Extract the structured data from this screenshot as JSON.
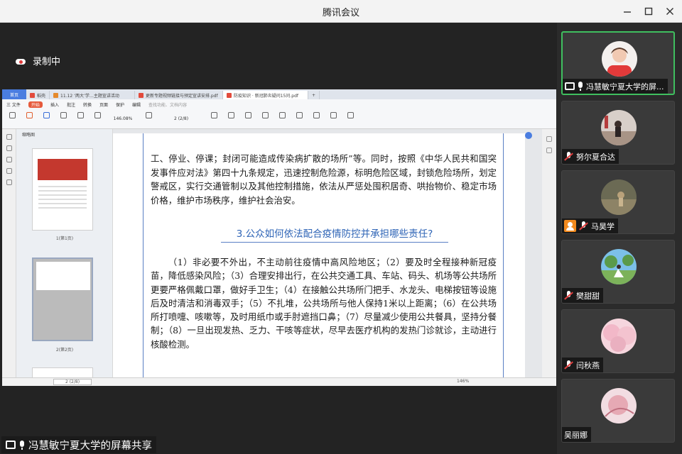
{
  "window": {
    "title": "腾讯会议"
  },
  "stage": {
    "recording_label": "录制中"
  },
  "wps": {
    "tabs": [
      {
        "label": "首页"
      },
      {
        "label": "稻壳"
      },
      {
        "label": "11.12 ‘两大’学…主题宣讲活动"
      },
      {
        "label": "更新专题视频链接与预定宣讲安排.pdf"
      },
      {
        "label": "防疫知识 · 新冠肺炎疑问15问.pdf"
      }
    ],
    "menu": [
      "三 文件",
      "开始",
      "插入",
      "批注",
      "转换",
      "页面",
      "保护",
      "编辑",
      "查找功能、文档内容"
    ],
    "zoom": "146.08%",
    "page_indicator": "2 (2/8)",
    "thumb_header": "缩略图",
    "thumb_labels": [
      "1(第1页)",
      "2(第2页)"
    ],
    "status_page": "2 (2/8)",
    "status_zoom": "146%"
  },
  "document": {
    "para1": "工、停业、停课；封闭可能造成传染病扩散的场所”等。同时，按照《中华人民共和国突发事件应对法》第四十九条规定，迅速控制危险源，标明危险区域，封锁危险场所，划定警戒区，实行交通管制以及其他控制措施，依法从严惩处囤积居奇、哄抬物价、稳定市场价格，维护市场秩序，维护社会治安。",
    "heading": "3.公众如何依法配合疫情防控并承担哪些责任?",
    "para2": "（1）非必要不外出，不主动前往疫情中高风险地区；（2）要及时全程接种新冠疫苗，降低感染风险；（3）合理安排出行，在公共交通工具、车站、码头、机场等公共场所更要严格佩戴口罩，做好手卫生；（4）在接触公共场所门把手、水龙头、电梯按钮等设施后及时清洁和消毒双手；（5）不扎堆，公共场所与他人保持1米以上距离；（6）在公共场所打喷嚏、咳嗽等，及时用纸巾或手肘遮挡口鼻；（7）尽量减少使用公共餐具，坚持分餐制；（8）一旦出现发热、乏力、干咳等症状，尽早去医疗机构的发热门诊就诊，主动进行核酸检测。"
  },
  "share_caption": "冯慧敏宁夏大学的屏幕共享",
  "participants": [
    {
      "name": "冯慧敏宁夏大学的屏...",
      "status": "sharing-speaking",
      "avatar_color": "#e23a3a"
    },
    {
      "name": "努尔夏合达",
      "status": "muted",
      "avatar_color": "#b9a89b"
    },
    {
      "name": "马昊学",
      "status": "muted",
      "avatar_color": "#7d7a60"
    },
    {
      "name": "樊甜甜",
      "status": "muted",
      "avatar_color": "#7cc0e8"
    },
    {
      "name": "闫秋燕",
      "status": "muted",
      "avatar_color": "#f3c3cf"
    },
    {
      "name": "吴丽娜",
      "status": "no-audio",
      "avatar_color": "#e8c3c9"
    }
  ]
}
